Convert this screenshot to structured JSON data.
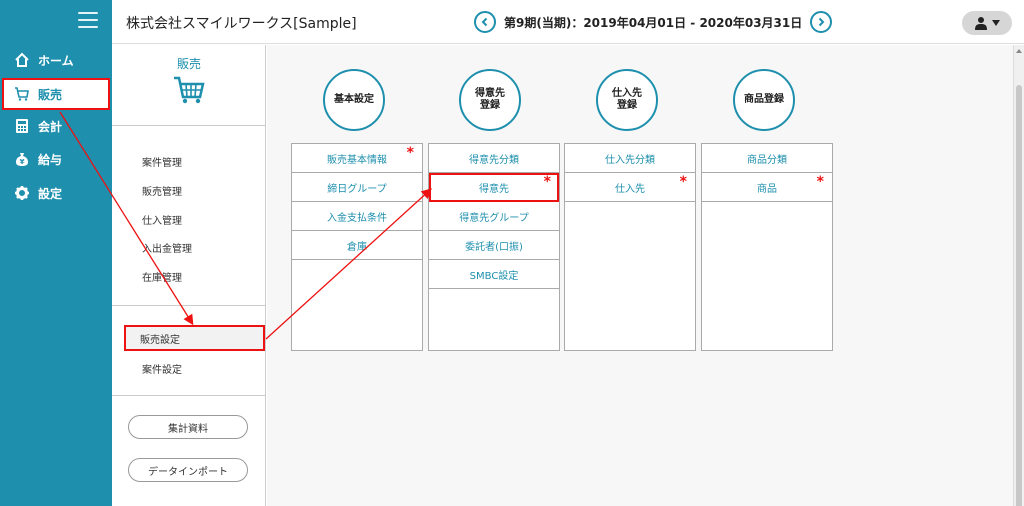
{
  "nav": {
    "items": [
      {
        "label": "ホーム",
        "icon": "home-icon"
      },
      {
        "label": "販売",
        "icon": "cart-icon"
      },
      {
        "label": "会計",
        "icon": "calculator-icon"
      },
      {
        "label": "給与",
        "icon": "yen-bag-icon"
      },
      {
        "label": "設定",
        "icon": "gear-icon"
      }
    ],
    "active_index": 1
  },
  "header": {
    "company": "株式会社スマイルワークス[Sample]",
    "period": "第9期(当期)：2019年04月01日 - 2020年03月31日"
  },
  "sidebar": {
    "title": "販売",
    "menu": [
      "案件管理",
      "販売管理",
      "仕入管理",
      "入出金管理",
      "在庫管理"
    ],
    "settings": [
      "販売設定",
      "案件設定"
    ],
    "buttons": [
      "集計資料",
      "データインポート"
    ]
  },
  "categories": [
    {
      "title": "基本設定",
      "items": [
        {
          "label": "販売基本情報",
          "star": true
        },
        {
          "label": "締日グループ",
          "star": false
        },
        {
          "label": "入金支払条件",
          "star": false
        },
        {
          "label": "倉庫",
          "star": false
        }
      ]
    },
    {
      "title": "得意先\n登録",
      "items": [
        {
          "label": "得意先分類",
          "star": false
        },
        {
          "label": "得意先",
          "star": true
        },
        {
          "label": "得意先グループ",
          "star": false
        },
        {
          "label": "委託者(口振)",
          "star": false
        },
        {
          "label": "SMBC設定",
          "star": false
        }
      ]
    },
    {
      "title": "仕入先\n登録",
      "items": [
        {
          "label": "仕入先分類",
          "star": false
        },
        {
          "label": "仕入先",
          "star": true
        }
      ]
    },
    {
      "title": "商品登録",
      "items": [
        {
          "label": "商品分類",
          "star": false
        },
        {
          "label": "商品",
          "star": true
        }
      ]
    }
  ],
  "colors": {
    "accent": "#1e8fad",
    "highlight": "#e11111",
    "nav_bg": "#1e8fad"
  }
}
